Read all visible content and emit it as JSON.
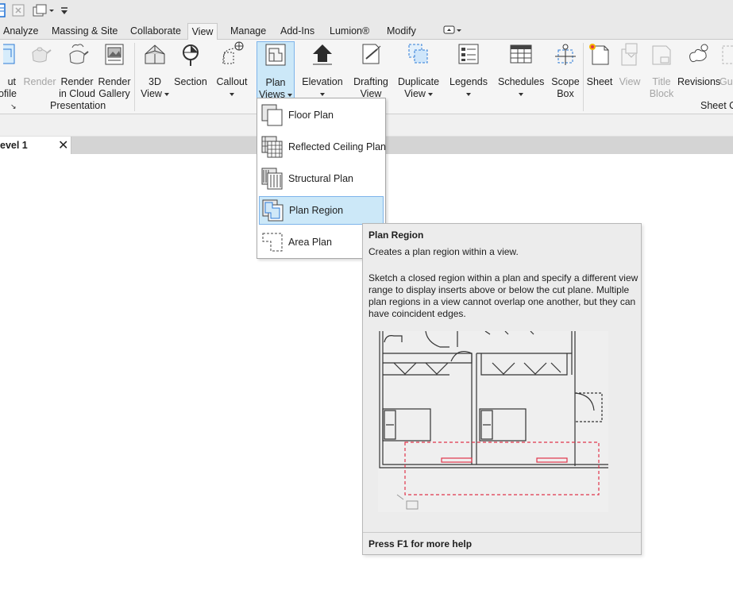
{
  "quick_access": {
    "items": [
      "view-icon",
      "close-hidden-icon",
      "switch-windows-icon",
      "qat-dropdown-icon"
    ]
  },
  "tabs": [
    {
      "label": "Analyze"
    },
    {
      "label": "Massing & Site"
    },
    {
      "label": "Collaborate"
    },
    {
      "label": "View"
    },
    {
      "label": "Manage"
    },
    {
      "label": "Add-Ins"
    },
    {
      "label": "Lumion®"
    },
    {
      "label": "Modify"
    }
  ],
  "ribbon": {
    "left_cut": {
      "line1": "ut",
      "line2": "ofile"
    },
    "render": {
      "label": "Render"
    },
    "render_cloud": {
      "line1": "Render",
      "line2": "in Cloud"
    },
    "render_gallery": {
      "line1": "Render",
      "line2": "Gallery"
    },
    "view_3d": {
      "line1": "3D",
      "line2": "View"
    },
    "section": {
      "label": "Section"
    },
    "callout": {
      "label": "Callout"
    },
    "plan_views": {
      "line1": "Plan",
      "line2": "Views"
    },
    "elevation": {
      "label": "Elevation"
    },
    "drafting_view": {
      "line1": "Drafting",
      "line2": "View"
    },
    "duplicate_view": {
      "line1": "Duplicate",
      "line2": "View"
    },
    "legends": {
      "label": "Legends"
    },
    "schedules": {
      "label": "Schedules"
    },
    "scope_box": {
      "line1": "Scope",
      "line2": "Box"
    },
    "sheet": {
      "label": "Sheet"
    },
    "view": {
      "label": "View"
    },
    "title_block": {
      "line1": "Title",
      "line2": "Block"
    },
    "revisions": {
      "label": "Revisions"
    },
    "guide_cut": {
      "label": "Gu"
    },
    "panel_presentation": "Presentation",
    "panel_sheet": "Sheet C"
  },
  "view_tab": {
    "label": "evel 1",
    "close": "✕"
  },
  "dropdown": {
    "items": [
      {
        "label": "Floor Plan"
      },
      {
        "label": "Reflected Ceiling Plan"
      },
      {
        "label": "Structural Plan"
      },
      {
        "label": "Plan Region"
      },
      {
        "label": "Area Plan"
      }
    ]
  },
  "tooltip": {
    "title": "Plan Region",
    "description": "Creates a plan region within a view.",
    "details": "Sketch a closed region within a plan and specify a different view range to display inserts above or below the cut plane. Multiple plan regions in a view cannot overlap one another, but they can have coincident edges.",
    "help": "Press F1 for more help"
  },
  "colors": {
    "highlight_bg": "#cce8f8",
    "highlight_border": "#7eb4ea",
    "region_red": "#e0354a"
  }
}
